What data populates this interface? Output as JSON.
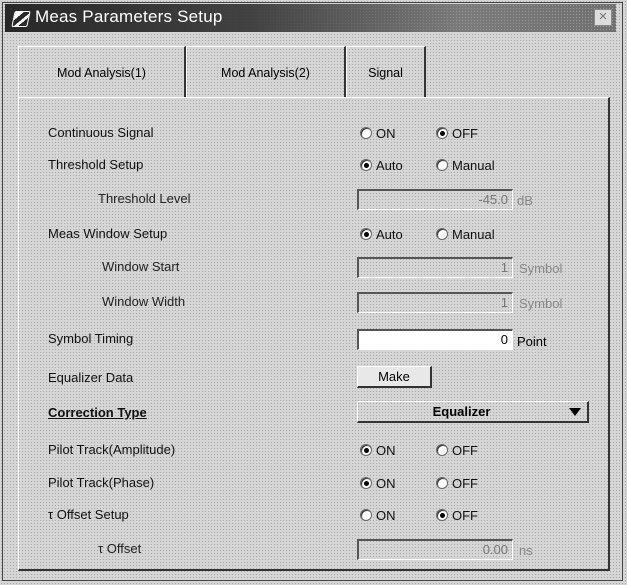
{
  "window": {
    "title": "Meas Parameters Setup",
    "close_label": "×"
  },
  "tabs": [
    "Mod Analysis(1)",
    "Mod Analysis(2)",
    "Signal"
  ],
  "rows": {
    "continuous_signal": {
      "label": "Continuous Signal",
      "options": [
        "ON",
        "OFF"
      ],
      "selected": "OFF"
    },
    "threshold_setup": {
      "label": "Threshold Setup",
      "options": [
        "Auto",
        "Manual"
      ],
      "selected": "Auto"
    },
    "threshold_level": {
      "label": "Threshold Level",
      "value": "-45.0",
      "unit": "dB"
    },
    "meas_window_setup": {
      "label": "Meas Window Setup",
      "options": [
        "Auto",
        "Manual"
      ],
      "selected": "Auto"
    },
    "window_start": {
      "label": "Window Start",
      "value": "1",
      "unit": "Symbol"
    },
    "window_width": {
      "label": "Window Width",
      "value": "1",
      "unit": "Symbol"
    },
    "symbol_timing": {
      "label": "Symbol Timing",
      "value": "0",
      "unit": "Point"
    },
    "equalizer_data": {
      "label": "Equalizer Data",
      "button": "Make"
    },
    "correction_type": {
      "label": "Correction Type",
      "selected": "Equalizer"
    },
    "pilot_track_amplitude": {
      "label": "Pilot Track(Amplitude)",
      "options": [
        "ON",
        "OFF"
      ],
      "selected": "ON"
    },
    "pilot_track_phase": {
      "label": "Pilot Track(Phase)",
      "options": [
        "ON",
        "OFF"
      ],
      "selected": "ON"
    },
    "tau_offset_setup": {
      "label": "τ  Offset Setup",
      "options": [
        "ON",
        "OFF"
      ],
      "selected": "OFF"
    },
    "tau_offset": {
      "label": "τ  Offset",
      "value": "0.00",
      "unit": "ns"
    }
  }
}
